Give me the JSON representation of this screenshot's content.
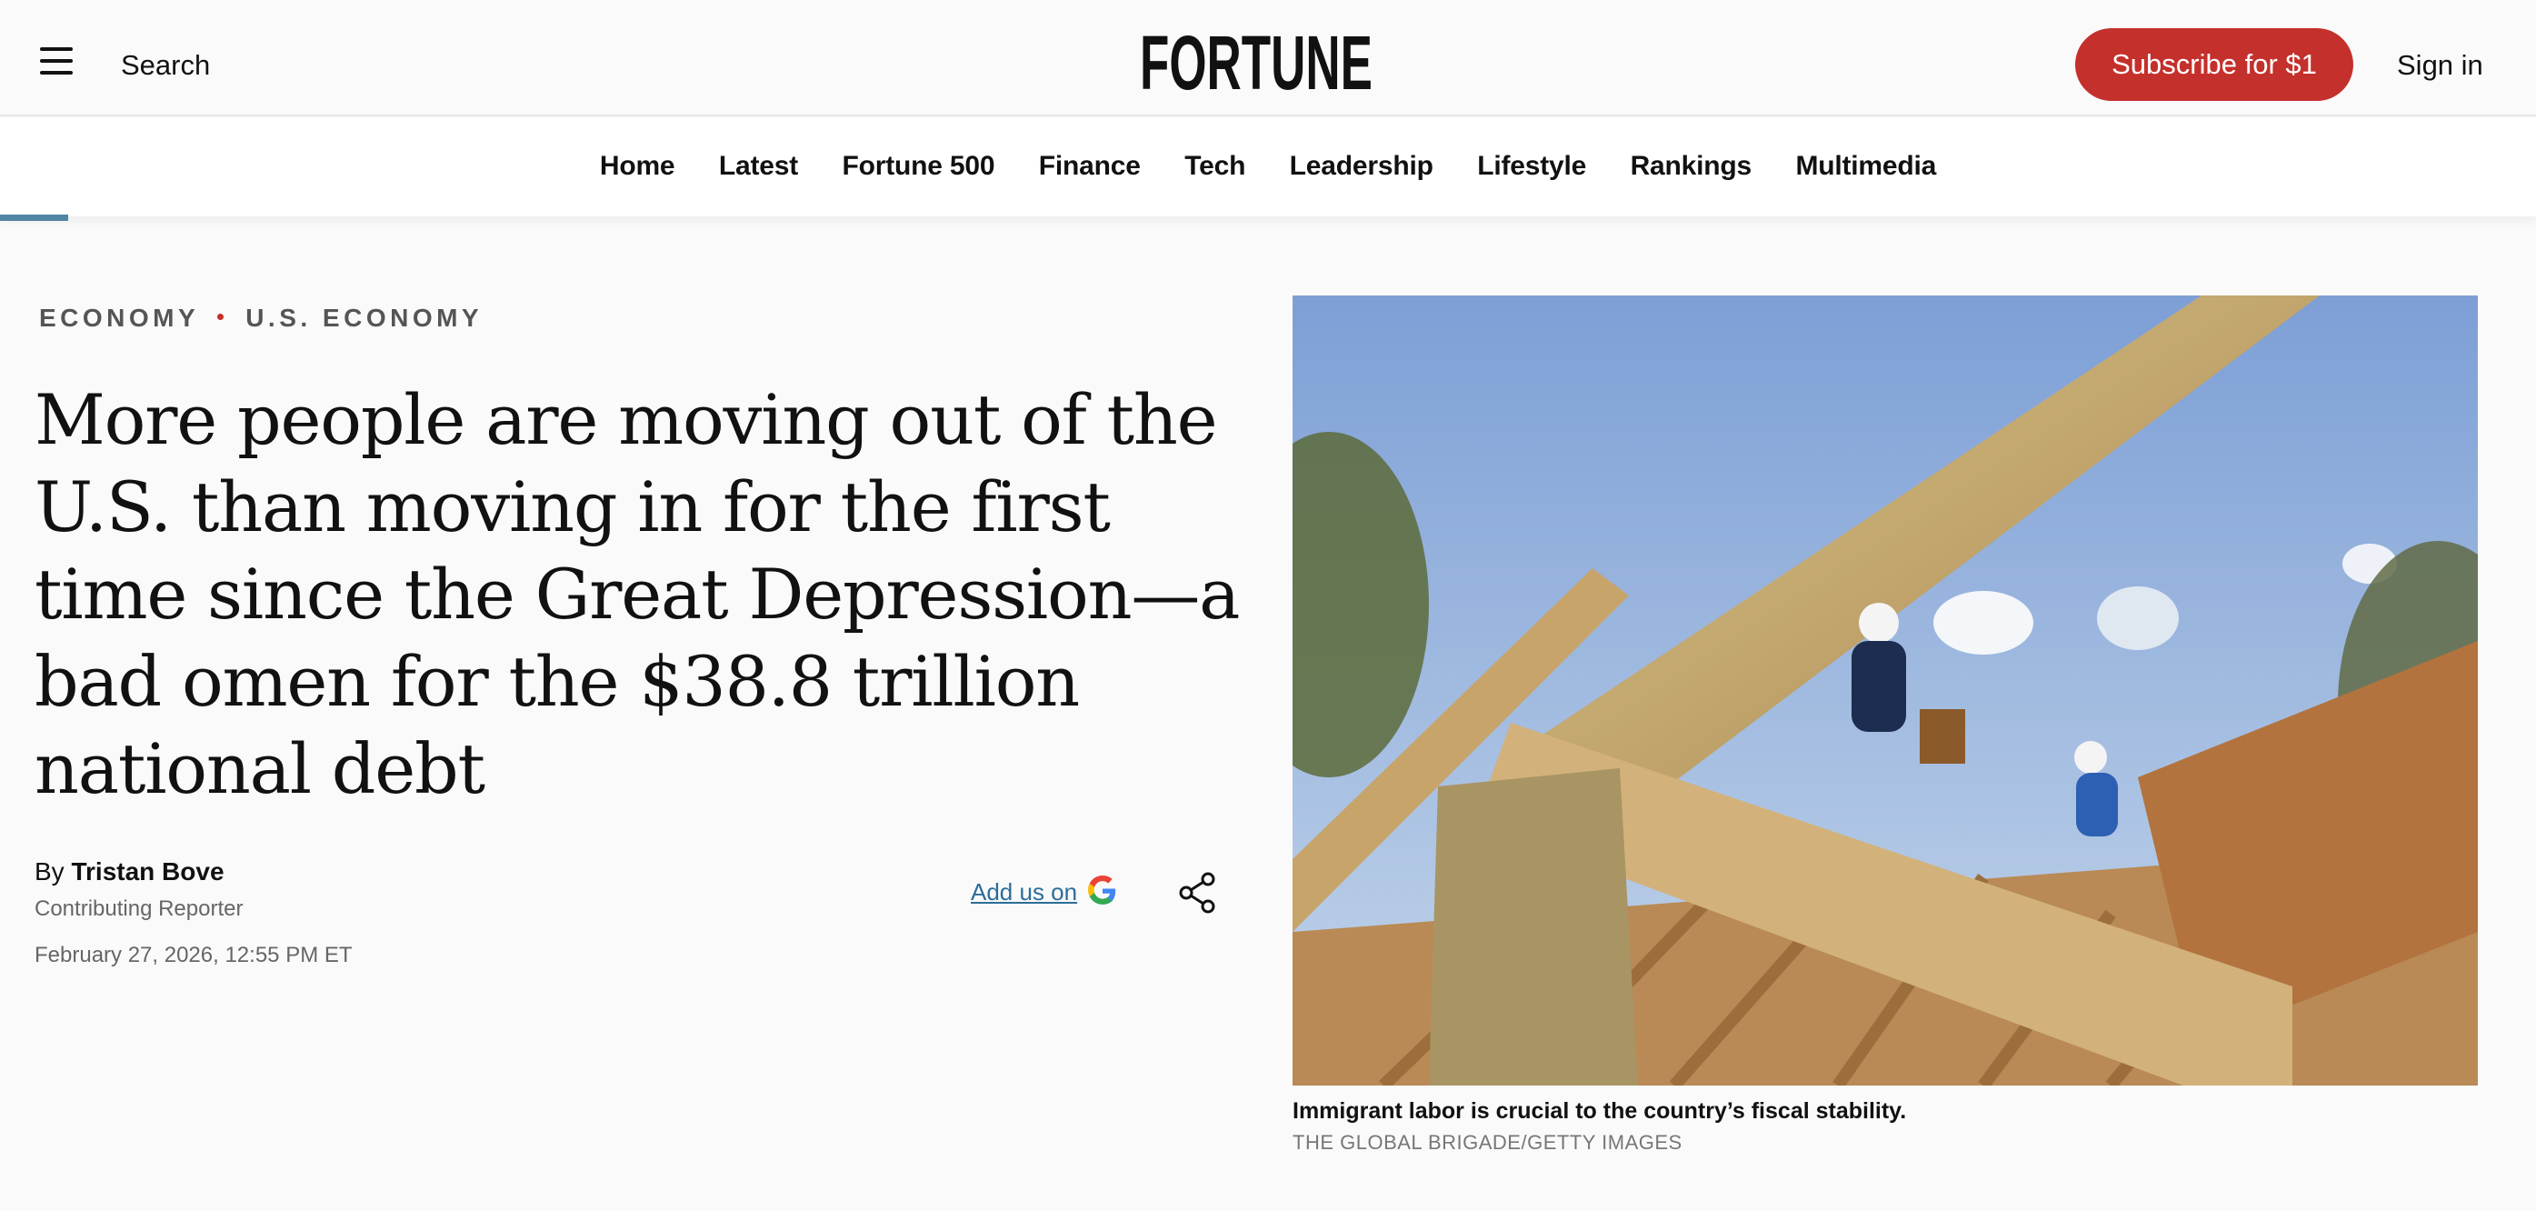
{
  "header": {
    "search_label": "Search",
    "logo_text": "FORTUNE",
    "subscribe_label": "Subscribe for $1",
    "signin_label": "Sign in"
  },
  "nav": {
    "items": [
      "Home",
      "Latest",
      "Fortune 500",
      "Finance",
      "Tech",
      "Leadership",
      "Lifestyle",
      "Rankings",
      "Multimedia"
    ]
  },
  "reading_progress": 0.027,
  "article": {
    "category": "ECONOMY",
    "subcategory": "U.S. ECONOMY",
    "headline": "More people are moving out of the U.S. than moving in for the first time since the Great Depression—a bad omen for the $38.8 trillion national debt",
    "byline_prefix": "By",
    "author": "Tristan Bove",
    "author_role": "Contributing Reporter",
    "date": "February 27, 2026, 12:55 PM ET",
    "add_google_label": "Add us on",
    "image_caption": "Immigrant labor is crucial to the country’s fiscal stability.",
    "image_credit": "THE GLOBAL BRIGADE/GETTY IMAGES"
  },
  "icons": {
    "menu": "hamburger-icon",
    "google": "google-g-icon",
    "share": "share-icon"
  },
  "colors": {
    "brand_red": "#c4302b",
    "link_blue": "#2b6e9a",
    "progress": "#4f86a3"
  }
}
